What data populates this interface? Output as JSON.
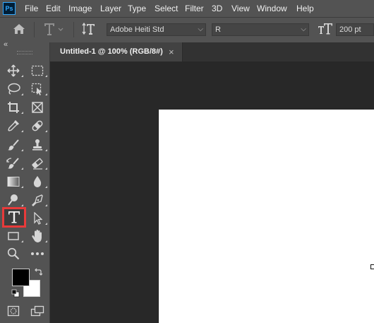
{
  "app": {
    "logo_text": "Ps"
  },
  "menu": [
    "File",
    "Edit",
    "Image",
    "Layer",
    "Type",
    "Select",
    "Filter",
    "3D",
    "View",
    "Window",
    "Help"
  ],
  "options": {
    "font_family": "Adobe Heiti Std",
    "font_style": "R",
    "font_size": "200 pt"
  },
  "document": {
    "tab_title": "Untitled-1 @ 100% (RGB/8#)",
    "close_glyph": "×"
  },
  "tools": {
    "selected": "type-tool",
    "highlight_color": "#e83a3a",
    "foreground_color": "#000000",
    "background_color": "#ffffff"
  },
  "collapse_glyph": "«"
}
